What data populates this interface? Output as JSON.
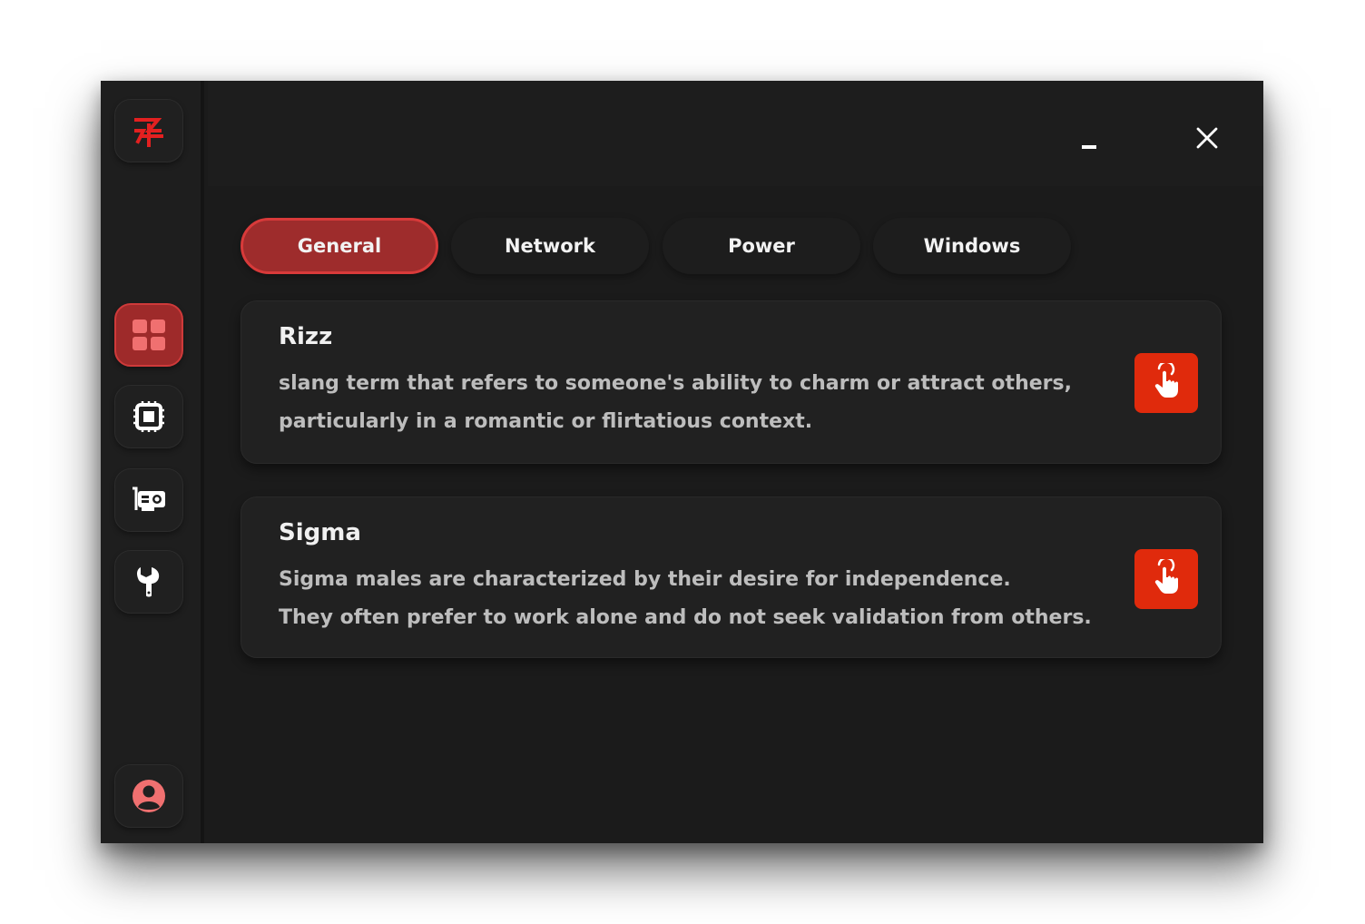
{
  "app": {
    "brand_icon": "logo-icon",
    "accent_color": "#e02a0c",
    "active_color": "#9e2c2c"
  },
  "sidebar": {
    "items": [
      {
        "icon": "grid-icon",
        "active": true
      },
      {
        "icon": "cpu-chip-icon",
        "active": false
      },
      {
        "icon": "gpu-card-icon",
        "active": false
      },
      {
        "icon": "wrench-icon",
        "active": false
      }
    ],
    "profile_icon": "user-circle-icon"
  },
  "window_controls": {
    "minimize_icon": "minimize-icon",
    "close_icon": "close-icon"
  },
  "tabs": [
    {
      "label": "General",
      "active": true
    },
    {
      "label": "Network",
      "active": false
    },
    {
      "label": "Power",
      "active": false
    },
    {
      "label": "Windows",
      "active": false
    }
  ],
  "tweaks": [
    {
      "title": "Rizz",
      "description_lines": [
        "slang term that refers to someone's ability to charm or attract others,",
        "particularly in a romantic or flirtatious context."
      ],
      "action_icon": "tap-hand-icon"
    },
    {
      "title": "Sigma",
      "description_lines": [
        "Sigma males are characterized by their desire for independence.",
        "They often prefer to work alone and do not seek validation from others."
      ],
      "action_icon": "tap-hand-icon"
    }
  ]
}
